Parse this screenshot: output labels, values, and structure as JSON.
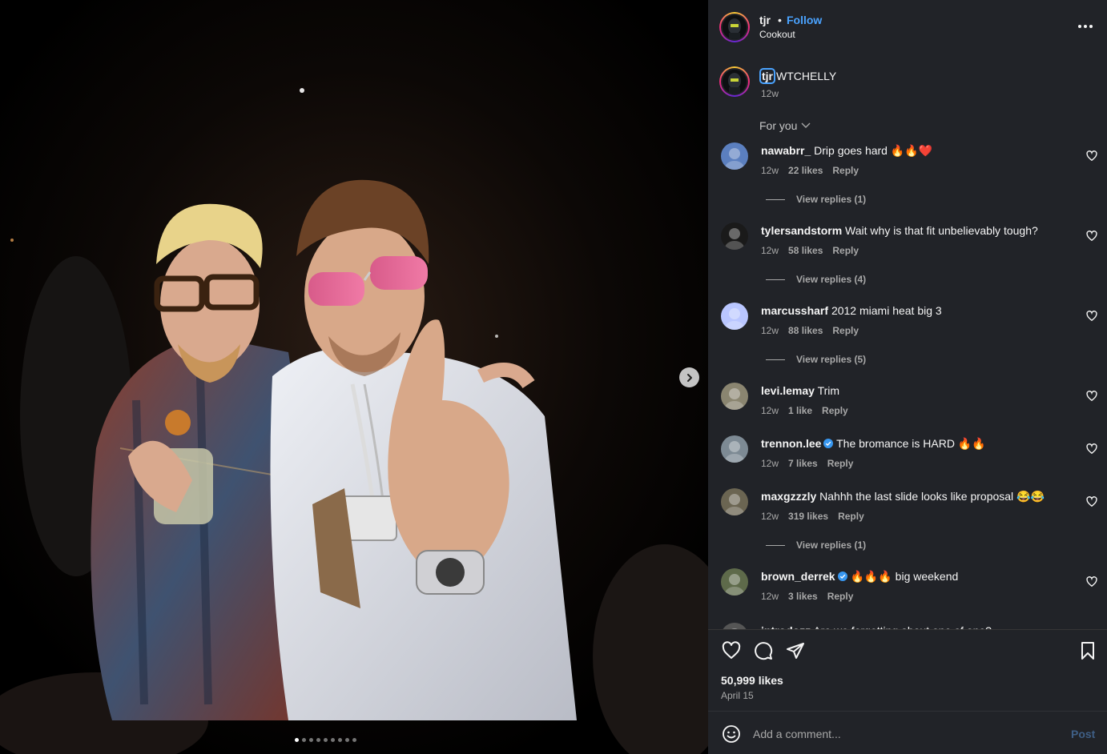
{
  "post": {
    "username": "tjr",
    "separator": "•",
    "follow_label": "Follow",
    "subtitle": "Cookout",
    "caption_user": "tjr",
    "caption_text": "WTCHELLY",
    "caption_time": "12w",
    "sort_label": "For you",
    "likes": "50,999 likes",
    "date": "April 15",
    "carousel_count": 9,
    "carousel_active": 0
  },
  "comments": [
    {
      "user": "nawabrr_",
      "verified": false,
      "text": "Drip goes hard 🔥🔥❤️",
      "time": "12w",
      "likes": "22 likes",
      "reply": "Reply",
      "view_replies": "View replies (1)",
      "avatar_color": "#5b7fbf"
    },
    {
      "user": "tylersandstorm",
      "verified": false,
      "text": "Wait why is that fit unbelievably tough?",
      "time": "12w",
      "likes": "58 likes",
      "reply": "Reply",
      "view_replies": "View replies (4)",
      "avatar_color": "#1a1a1a"
    },
    {
      "user": "marcussharf",
      "verified": false,
      "text": "2012 miami heat big 3",
      "time": "12w",
      "likes": "88 likes",
      "reply": "Reply",
      "view_replies": "View replies (5)",
      "avatar_color": "#b9c6ff"
    },
    {
      "user": "levi.lemay",
      "verified": false,
      "text": "Trim",
      "time": "12w",
      "likes": "1 like",
      "reply": "Reply",
      "view_replies": "",
      "avatar_color": "#8a8570"
    },
    {
      "user": "trennon.lee",
      "verified": true,
      "text": "The bromance is HARD 🔥🔥",
      "time": "12w",
      "likes": "7 likes",
      "reply": "Reply",
      "view_replies": "",
      "avatar_color": "#7d8a94"
    },
    {
      "user": "maxgzzzly",
      "verified": false,
      "text": "Nahhh the last slide looks like proposal 😂😂",
      "time": "12w",
      "likes": "319 likes",
      "reply": "Reply",
      "view_replies": "View replies (1)",
      "avatar_color": "#6b6552"
    },
    {
      "user": "brown_derrek",
      "verified": true,
      "text": "🔥🔥🔥 big weekend",
      "time": "12w",
      "likes": "3 likes",
      "reply": "Reply",
      "view_replies": "",
      "avatar_color": "#5e6a4a"
    },
    {
      "user": "introdozz",
      "verified": false,
      "text": "Are we forgetting about one of one?",
      "time": "",
      "likes": "",
      "reply": "",
      "view_replies": "",
      "avatar_color": "#555"
    }
  ],
  "input": {
    "placeholder": "Add a comment...",
    "post_label": "Post"
  },
  "colors": {
    "panel_bg": "#212328",
    "link_blue": "#4aa3ff",
    "muted": "#a8a8a8"
  },
  "icons": {
    "like": "heart-icon",
    "comment": "comment-icon",
    "share": "paper-plane-icon",
    "save": "bookmark-icon",
    "emoji": "smiley-icon",
    "next": "chevron-right-icon",
    "more": "more-horizontal-icon"
  }
}
